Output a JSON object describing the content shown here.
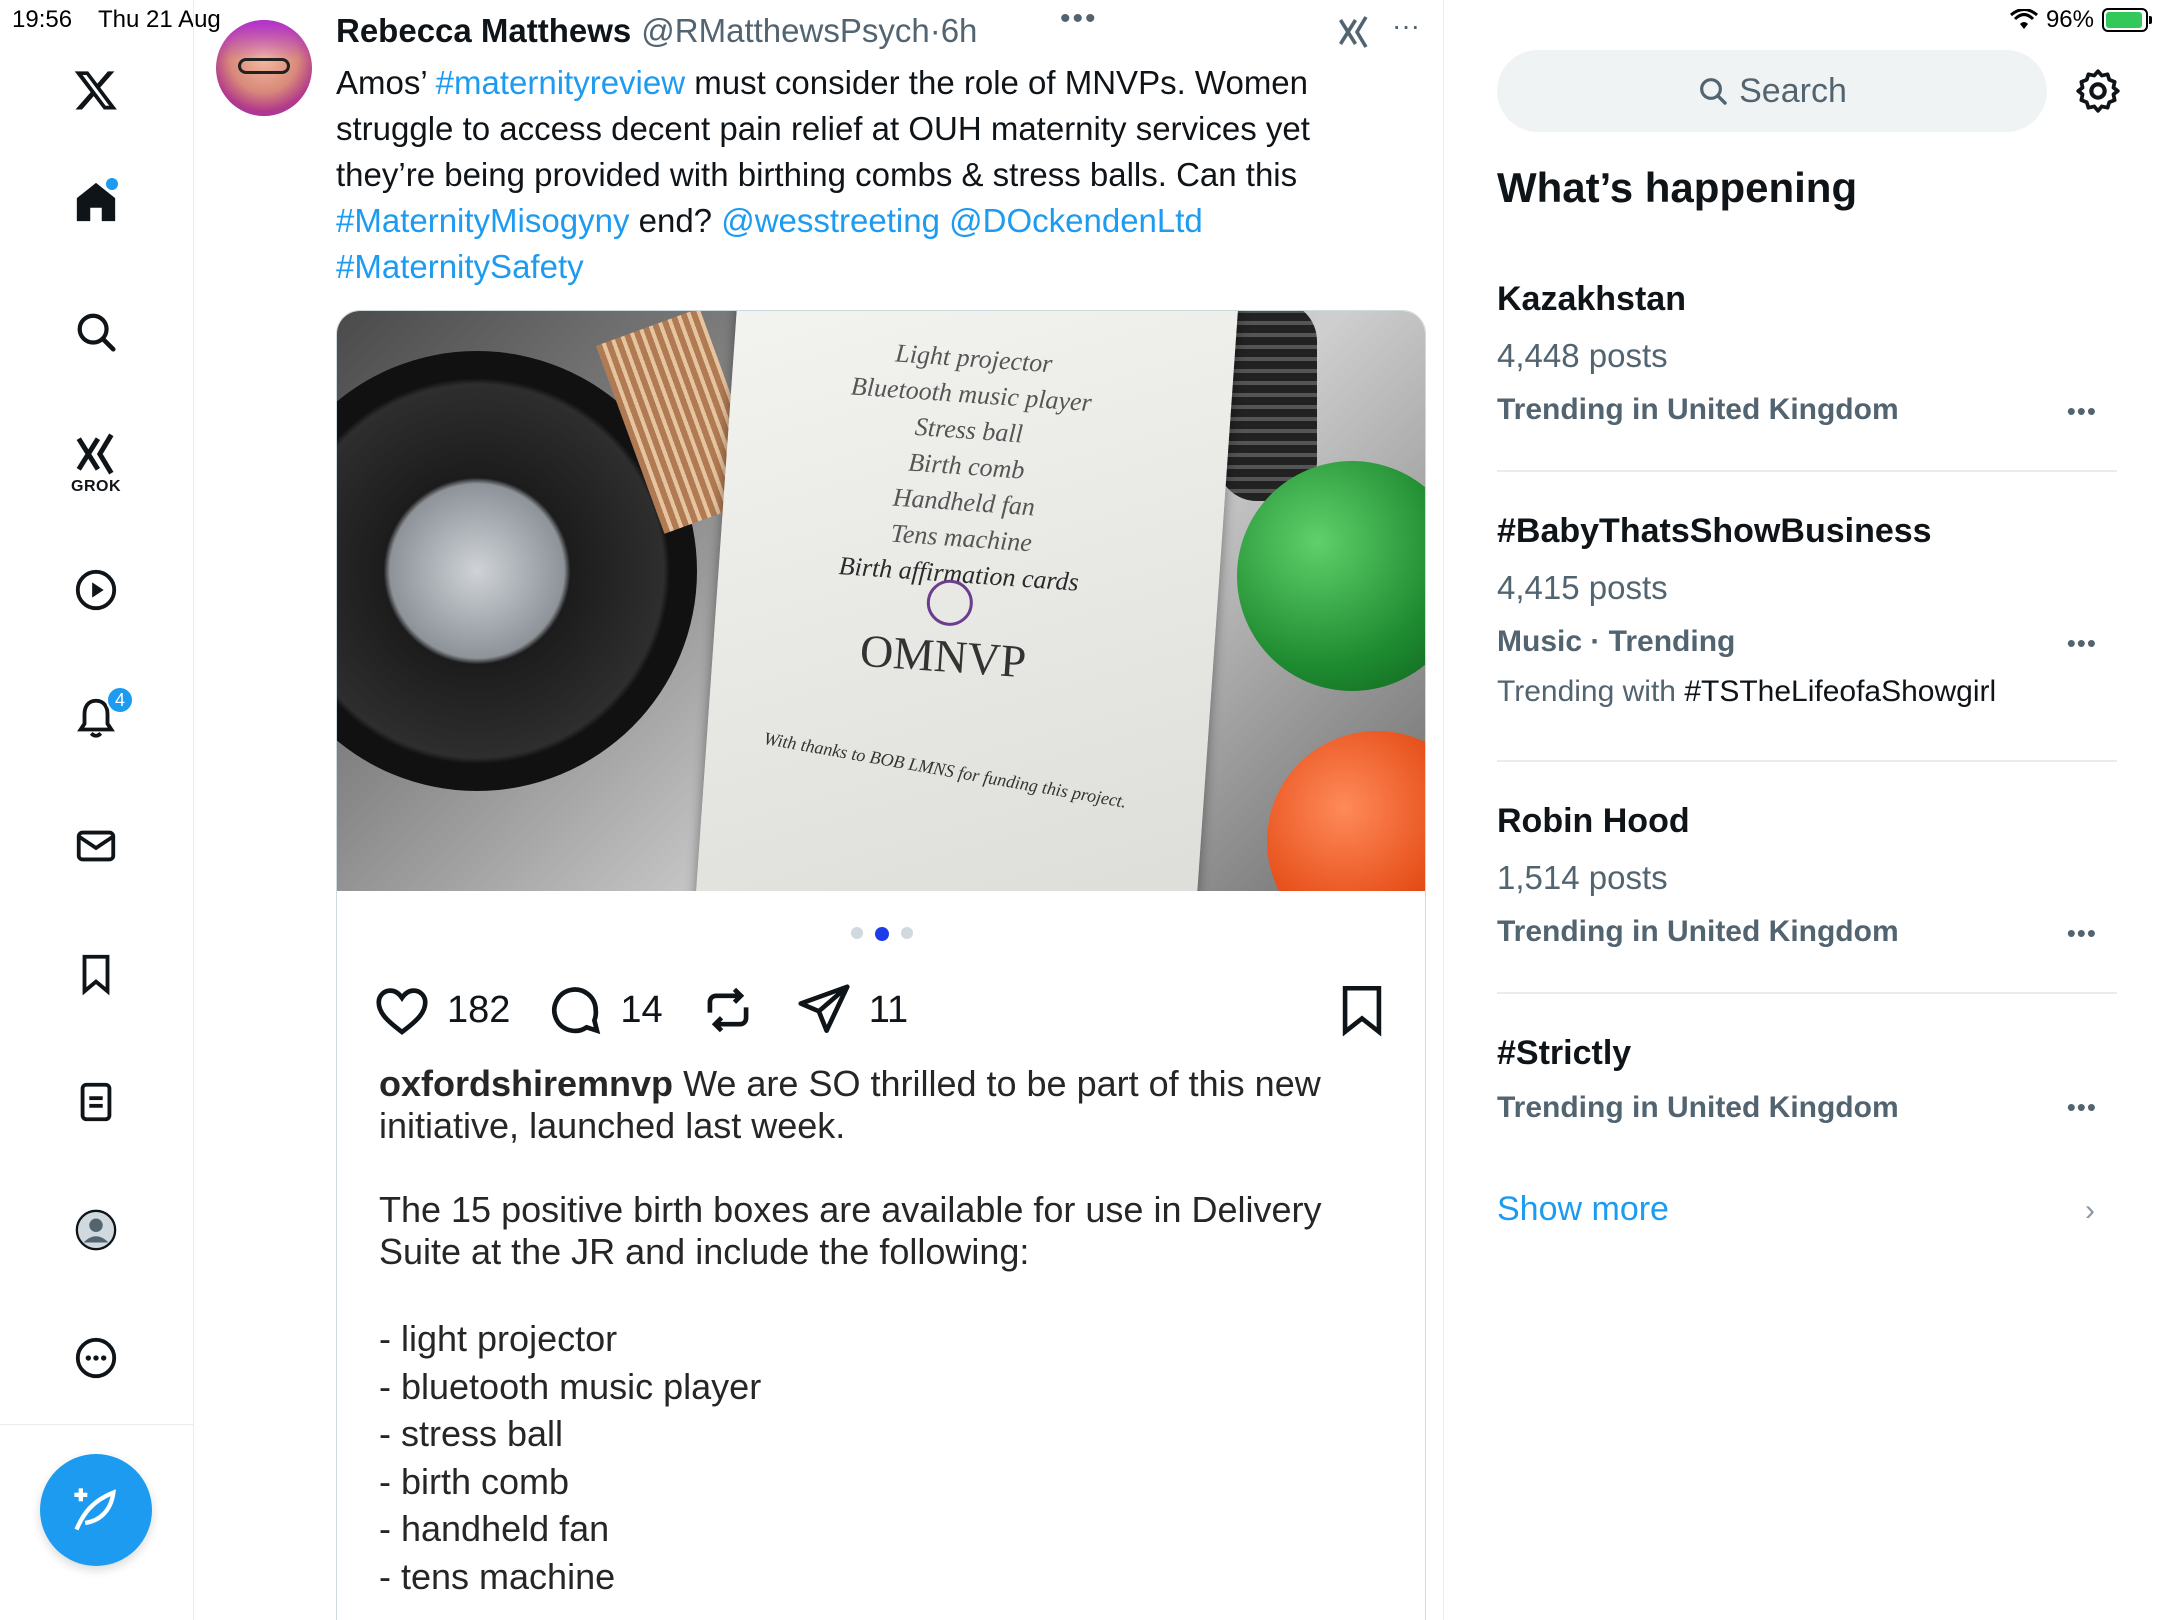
{
  "status_bar": {
    "time": "19:56",
    "date": "Thu 21 Aug",
    "battery": "96%",
    "battery_level": 0.96
  },
  "nav": {
    "items": [
      "home",
      "search",
      "grok",
      "video",
      "notifications",
      "messages",
      "bookmarks",
      "lists",
      "profile",
      "more"
    ],
    "grok_label": "GROK",
    "notifications_count": "4"
  },
  "tweet": {
    "author_name": "Rebecca Matthews",
    "author_handle": "@RMatthewsPsych",
    "separator": "·",
    "time_ago": "6h",
    "text_segments": [
      {
        "text": "Amos’ ",
        "link": false
      },
      {
        "text": "#maternityreview",
        "link": true
      },
      {
        "text": " must consider the role of MNVPs. Women struggle to access decent pain relief at OUH maternity services yet they’re being provided with birthing combs & stress balls. Can this ",
        "link": false
      },
      {
        "text": "#MaternityMisogyny",
        "link": true
      },
      {
        "text": " end? ",
        "link": false
      },
      {
        "text": "@wesstreeting",
        "link": true
      },
      {
        "text": " ",
        "link": false
      },
      {
        "text": "@DOckendenLtd",
        "link": true
      },
      {
        "text": " ",
        "link": false
      },
      {
        "text": "#MaternitySafety",
        "link": true
      }
    ],
    "photo_paper": {
      "items": [
        "Light projector",
        "Bluetooth music player",
        "Stress ball",
        "Birth comb",
        "Handheld fan",
        "Tens machine",
        "Birth affirmation cards"
      ],
      "logo": "OMNVP",
      "thanks": "With thanks to BOB LMNS for funding this project."
    },
    "pager": {
      "count": 3,
      "active": 1
    },
    "ig_post": {
      "likes": "182",
      "comments": "14",
      "shares": "11",
      "caption_user": "oxfordshiremnvp",
      "caption_intro": "We are SO thrilled to be part of this new initiative, launched last week.",
      "caption_para2": "The 15 positive birth boxes are available for use in Delivery Suite at the JR and include the following:",
      "caption_list": [
        "- light projector",
        "- bluetooth music player",
        "- stress ball",
        "- birth comb",
        "- handheld fan",
        "- tens machine"
      ]
    }
  },
  "sidebar": {
    "search_placeholder": "Search",
    "title": "What’s happening",
    "trends": [
      {
        "name": "Kazakhstan",
        "posts": "4,448 posts",
        "context": "Trending in United Kingdom"
      },
      {
        "name": "#BabyThatsShowBusiness",
        "posts": "4,415 posts",
        "context": "Music · Trending",
        "with_prefix": "Trending with",
        "with_tag": "#TSTheLifeofaShowgirl"
      },
      {
        "name": "Robin Hood",
        "posts": "1,514 posts",
        "context": "Trending in United Kingdom"
      },
      {
        "name": "#Strictly",
        "context": "Trending in United Kingdom"
      }
    ],
    "show_more": "Show more"
  },
  "colors": {
    "accent": "#1d9bf0",
    "text_primary": "#0f1419",
    "text_secondary": "#536471",
    "divider": "#e6ecf0"
  }
}
